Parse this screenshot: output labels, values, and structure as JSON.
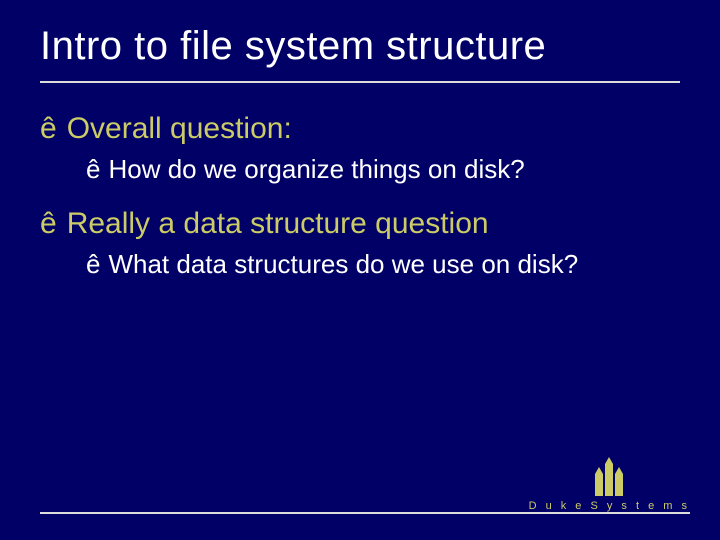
{
  "title": "Intro to file system structure",
  "bullets": [
    {
      "level": 1,
      "marker": "ê",
      "text": "Overall question:"
    },
    {
      "level": 2,
      "marker": "ê",
      "text": "How do we organize things on disk?"
    },
    {
      "level": 1,
      "marker": "ê",
      "text": "Really a data structure question"
    },
    {
      "level": 2,
      "marker": "ê",
      "text": "What data structures do we use on disk?"
    }
  ],
  "footer": {
    "brand": "D u k e   S y s t e m s"
  }
}
